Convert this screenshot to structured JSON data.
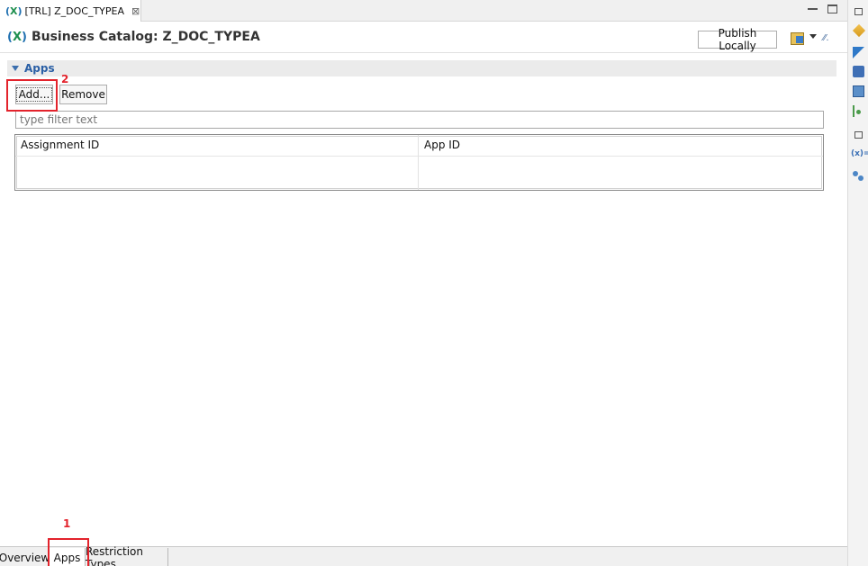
{
  "editor_tab": {
    "label": "[TRL] Z_DOC_TYPEA",
    "icon": "variable-icon",
    "close_glyph": "⊠"
  },
  "header": {
    "title": "Business Catalog: Z_DOC_TYPEA",
    "publish_label": "Publish Locally"
  },
  "apps_section": {
    "title": "Apps",
    "add_label": "Add...",
    "remove_label": "Remove",
    "filter_placeholder": "type filter text",
    "columns": [
      "Assignment ID",
      "App ID"
    ],
    "rows": []
  },
  "annotations": {
    "step_1": "1",
    "step_2": "2"
  },
  "bottom_tabs": [
    {
      "label": "Overview",
      "active": false
    },
    {
      "label": "Apps",
      "active": true
    },
    {
      "label": "Restriction Types",
      "active": false
    }
  ],
  "right_toolbar": {
    "variables_label": "(x)="
  },
  "colors": {
    "accent": "#2a5fa5",
    "annotation": "#e3232c",
    "variable_glyph": "#1e8f4e"
  }
}
